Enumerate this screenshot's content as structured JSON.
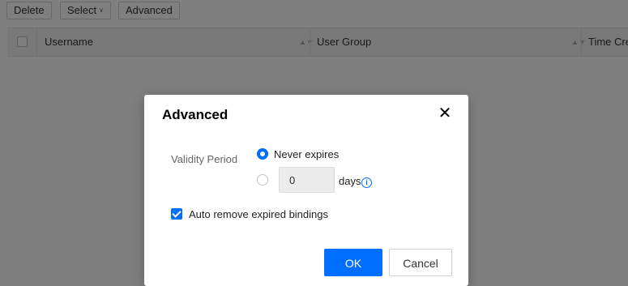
{
  "toolbar": {
    "delete_label": "Delete",
    "select_label": "Select",
    "advanced_label": "Advanced"
  },
  "table": {
    "columns": [
      "Username",
      "User Group",
      "Time Cre"
    ]
  },
  "dialog": {
    "title": "Advanced",
    "validity_label": "Validity Period",
    "option_never": "Never expires",
    "option_days_value": "0",
    "days_unit": "days",
    "auto_remove_label": "Auto remove expired bindings",
    "auto_remove_checked": true,
    "selected_option": "never",
    "ok_label": "OK",
    "cancel_label": "Cancel"
  },
  "colors": {
    "accent": "#006eff",
    "overlay": "rgba(0,0,0,0.5)"
  }
}
